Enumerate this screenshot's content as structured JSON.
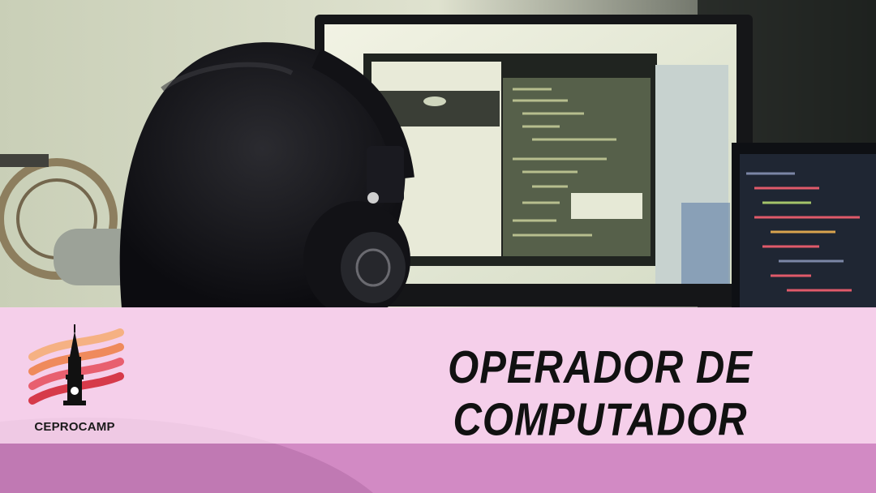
{
  "banner": {
    "title": "OPERADOR DE COMPUTADOR"
  },
  "logo": {
    "name": "CEPROCAMP",
    "colors": [
      "#e85f6f",
      "#ef8a5c",
      "#f5b183",
      "#d63a4a"
    ]
  },
  "colors": {
    "banner_pink": "#fad2ee",
    "banner_bottom": "#d678c4",
    "title_text": "#111111"
  }
}
